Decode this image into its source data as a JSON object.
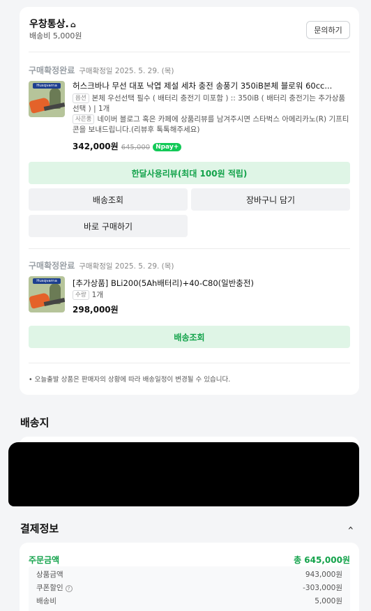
{
  "store": {
    "name": "우창통상.",
    "shipping_fee": "배송비 5,000원",
    "inquiry_button": "문의하기"
  },
  "orders": [
    {
      "status": "구매확정완료",
      "confirm_date": "구매확정일 2025. 5. 29. (목)",
      "product_name": "허스크바나 무선 대포 낙엽 제설 세차 충전 송풍기 350iB본체 블로워 60cc...",
      "thumb_brand": "Husqvarna",
      "option_tag": "옵션",
      "option_text": "본체 우선선택 필수 ( 배터리 충전기 미포함 ) :: 350iB ( 배터리 충전기는 추가상품 선택 )",
      "quantity": "1개",
      "request_tag": "사은품",
      "request_text": "네이버 블로그 혹은 카페에 상품리뷰를 남겨주시면 스타벅스 아메리카노(R) 기프티콘을 보내드립니다.(리뷰후 톡톡해주세요)",
      "price": "342,000원",
      "original_price": "645,000",
      "npay_label": "pay+",
      "review_button": "한달사용리뷰(최대 100원 적립)",
      "tracking_button": "배송조회",
      "cart_button": "장바구니 담기",
      "buy_again_button": "바로 구매하기"
    },
    {
      "status": "구매확정완료",
      "confirm_date": "구매확정일 2025. 5. 29. (목)",
      "product_name": "[추가상품] BLi200(5Ah배터리)+40-C80(일반충전)",
      "thumb_brand": "Husqvarna",
      "quantity_tag": "수량",
      "quantity": "1개",
      "price": "298,000원",
      "tracking_button": "배송조회"
    }
  ],
  "notice": "오늘출발 상품은 판매자의 상황에 따라 배송일정이 변경될 수 있습니다.",
  "address_section": {
    "title": "배송지"
  },
  "payment": {
    "title": "결제정보",
    "total_label": "주문금액",
    "total_value": "총 645,000원",
    "rows": [
      {
        "label": "상품금액",
        "value": "943,000원"
      },
      {
        "label": "쿠폰할인",
        "value": "-303,000원"
      },
      {
        "label": "배송비",
        "value": "5,000원"
      }
    ]
  },
  "icons": [
    "home-icon",
    "question-icon",
    "chevron-up-icon",
    "npay-icon"
  ],
  "colors": {
    "accent_green": "#12a24a",
    "green_bg": "#dff5e6",
    "page_bg": "#f4f5f7"
  }
}
